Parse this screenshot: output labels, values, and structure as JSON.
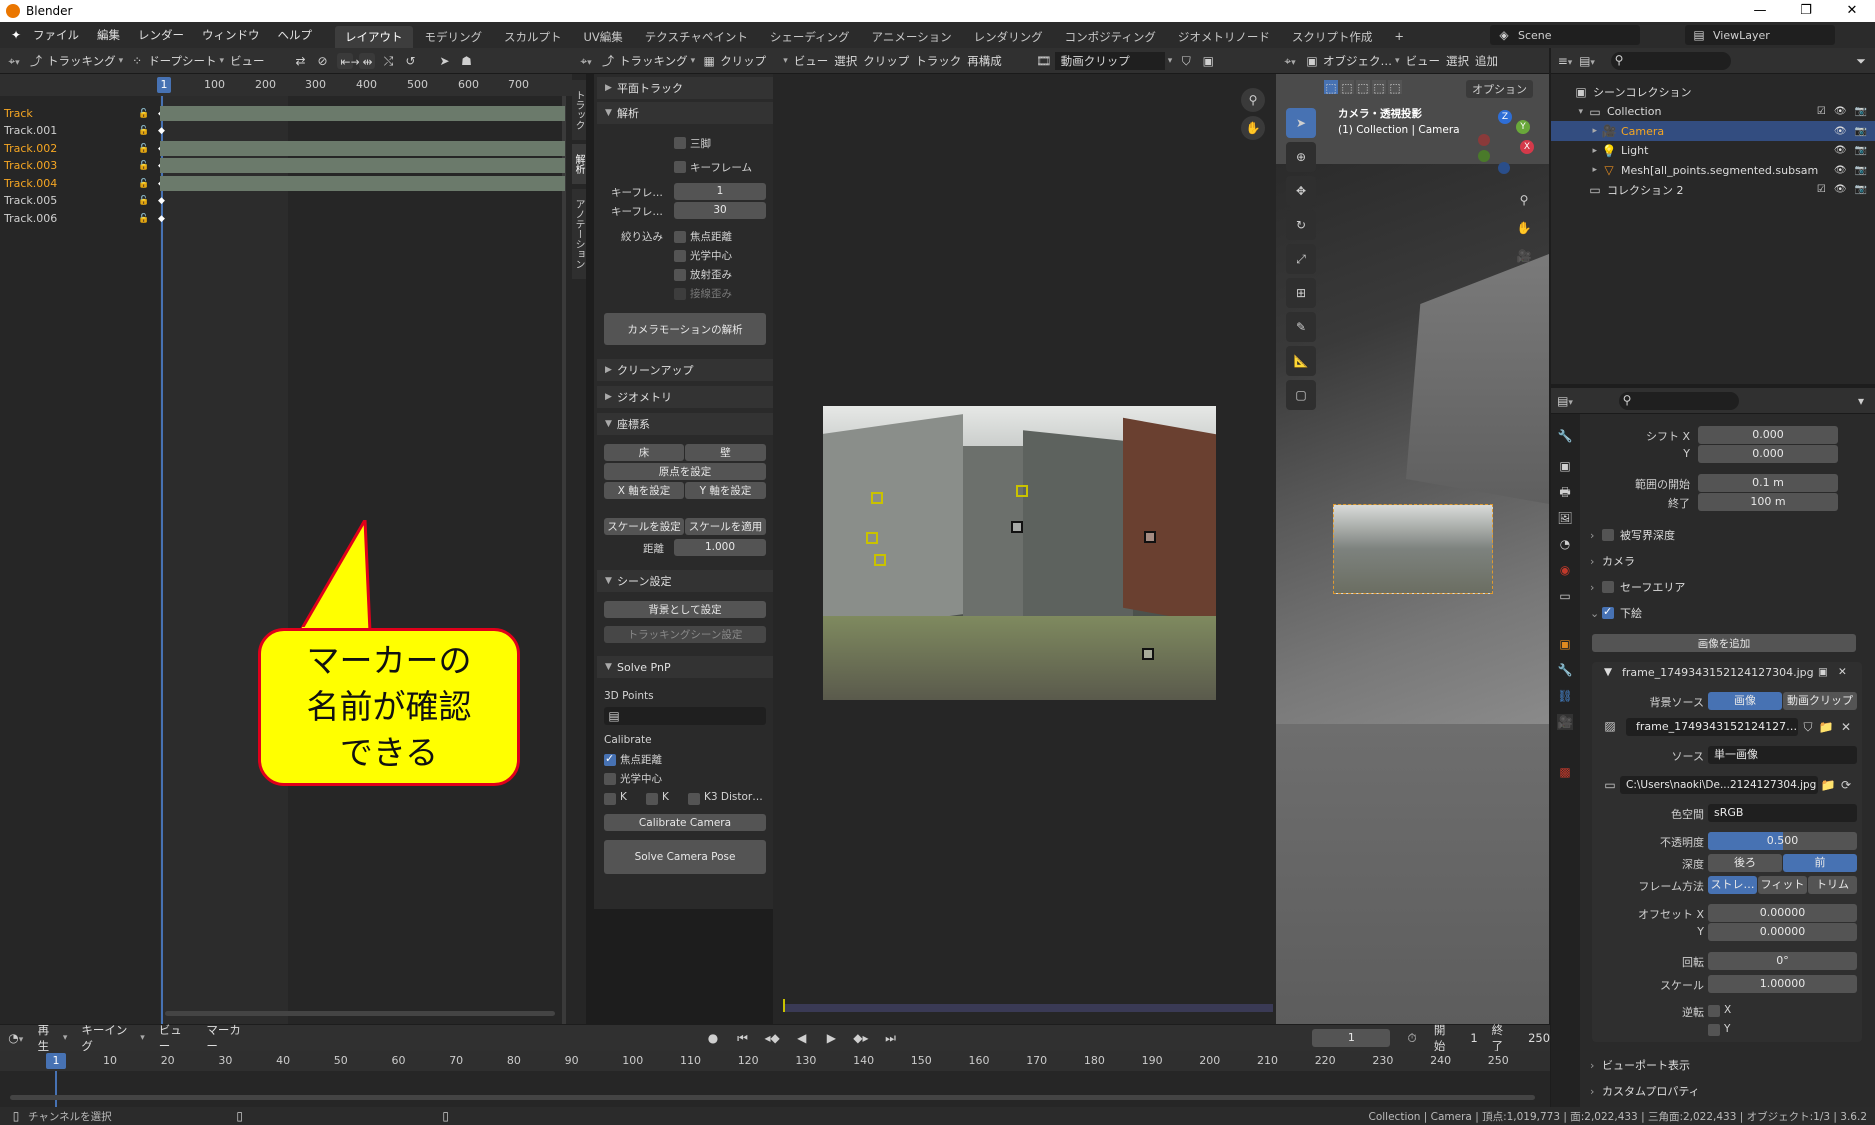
{
  "window": {
    "title": "Blender",
    "min": "—",
    "max": "❐",
    "close": "✕"
  },
  "menu": [
    "ファイル",
    "編集",
    "レンダー",
    "ウィンドウ",
    "ヘルプ"
  ],
  "workspaces": [
    "レイアウト",
    "モデリング",
    "スカルプト",
    "UV編集",
    "テクスチャペイント",
    "シェーディング",
    "アニメーション",
    "レンダリング",
    "コンポジティング",
    "ジオメトリノード",
    "スクリプト作成"
  ],
  "active_workspace": "レイアウト",
  "scene": {
    "scene_name": "Scene",
    "view_layer": "ViewLayer"
  },
  "dopesheet": {
    "mode": "トラッキング",
    "editor": "ドープシート",
    "view": "ビュー",
    "current_frame": "1",
    "ruler": [
      "100",
      "200",
      "300",
      "400",
      "500",
      "600",
      "700"
    ],
    "tracks": [
      {
        "name": "Track",
        "selected": true,
        "bar": true
      },
      {
        "name": "Track.001",
        "selected": false,
        "bar": false
      },
      {
        "name": "Track.002",
        "selected": true,
        "bar": true
      },
      {
        "name": "Track.003",
        "selected": true,
        "bar": true
      },
      {
        "name": "Track.004",
        "selected": true,
        "bar": true
      },
      {
        "name": "Track.005",
        "selected": false,
        "bar": false
      },
      {
        "name": "Track.006",
        "selected": false,
        "bar": false
      }
    ]
  },
  "clip_header": {
    "mode": "トラッキング",
    "clip": "クリップ",
    "menus": [
      "ビュー",
      "選択",
      "クリップ",
      "トラック",
      "再構成"
    ],
    "clip_type": "動画クリップ"
  },
  "side_tabs": [
    "トラック",
    "解析",
    "アノテーション"
  ],
  "solve_panel": {
    "plane_track": "平面トラック",
    "solve": "解析",
    "tripod": "三脚",
    "keyframe": "キーフレーム",
    "keyframe_a_label": "キーフレ…",
    "keyframe_a": "1",
    "keyframe_b_label": "キーフレ…",
    "keyframe_b": "30",
    "refine_label": "絞り込み",
    "focal": "焦点距離",
    "optical_center": "光学中心",
    "radial": "放射歪み",
    "tangential": "接線歪み",
    "solve_btn": "カメラモーションの解析",
    "cleanup": "クリーンアップ",
    "geometry": "ジオメトリ",
    "orientation": "座標系",
    "floor": "床",
    "wall": "壁",
    "set_origin": "原点を設定",
    "set_x": "X 軸を設定",
    "set_y": "Y 軸を設定",
    "set_scale": "スケールを設定",
    "apply_scale": "スケールを適用",
    "distance_label": "距離",
    "distance": "1.000",
    "scene_setup": "シーン設定",
    "set_bg": "背景として設定",
    "tracking_scene": "トラッキングシーン設定",
    "solve_pnp": "Solve PnP",
    "points_3d": "3D Points",
    "calibrate": "Calibrate",
    "cal_focal": "焦点距離",
    "cal_optical": "光学中心",
    "k1": "K",
    "k2": "K",
    "k3": "K3 Distor…",
    "calibrate_btn": "Calibrate Camera",
    "solve_pose_btn": "Solve Camera Pose"
  },
  "viewport": {
    "mode": "オブジェク…",
    "menus": [
      "ビュー",
      "選択",
      "追加"
    ],
    "options": "オプション",
    "camera_text": "カメラ・透視投影",
    "collection_text": "(1) Collection | Camera"
  },
  "outliner": {
    "rows": [
      {
        "label": "シーンコレクション",
        "depth": 0
      },
      {
        "label": "Collection",
        "depth": 1
      },
      {
        "label": "Camera",
        "depth": 2,
        "selected": true
      },
      {
        "label": "Light",
        "depth": 2
      },
      {
        "label": "Mesh[all_points.segmented.subsam",
        "depth": 2
      },
      {
        "label": "コレクション 2",
        "depth": 1
      }
    ]
  },
  "properties": {
    "shift_x_label": "シフト X",
    "shift_x": "0.000",
    "shift_y_label": "Y",
    "shift_y": "0.000",
    "clip_start_label": "範囲の開始",
    "clip_start": "0.1 m",
    "clip_end_label": "終了",
    "clip_end": "100 m",
    "dof": "被写界深度",
    "camera": "カメラ",
    "safe_area": "セーフエリア",
    "bg_images": "下絵",
    "add_image": "画像を追加",
    "image_name": "frame_1749343152124127304.jpg",
    "bg_source_label": "背景ソース",
    "bg_source_image": "画像",
    "bg_source_clip": "動画クリップ",
    "image_field": "frame_1749343152124127…",
    "source_label": "ソース",
    "source": "単一画像",
    "filepath": "C:\\Users\\naoki\\De...2124127304.jpg",
    "colorspace_label": "色空間",
    "colorspace": "sRGB",
    "opacity_label": "不透明度",
    "opacity": "0.500",
    "opacity_fraction": 0.5,
    "depth_label": "深度",
    "depth_back": "後ろ",
    "depth_front": "前",
    "frame_method_label": "フレーム方法",
    "frame_stretch": "ストレ…",
    "frame_fit": "フィット",
    "frame_crop": "トリム",
    "offset_x_label": "オフセット X",
    "offset_x": "0.00000",
    "offset_y_label": "Y",
    "offset_y": "0.00000",
    "rotation_label": "回転",
    "rotation": "0°",
    "scale_label": "スケール",
    "scale": "1.00000",
    "flip_label": "逆転",
    "flip_x": "X",
    "flip_y": "Y",
    "viewport_display": "ビューポート表示",
    "custom_props": "カスタムプロパティ"
  },
  "timeline": {
    "playback": "再生",
    "keying": "キーイング",
    "view": "ビュー",
    "marker": "マーカー",
    "frame": "1",
    "start_label": "開始",
    "start": "1",
    "end_label": "終了",
    "end": "250",
    "current": "1",
    "ticks": [
      "10",
      "20",
      "30",
      "40",
      "50",
      "60",
      "70",
      "80",
      "90",
      "100",
      "110",
      "120",
      "130",
      "140",
      "150",
      "160",
      "170",
      "180",
      "190",
      "200",
      "210",
      "220",
      "230",
      "240",
      "250"
    ]
  },
  "status": {
    "left": "チャンネルを選択",
    "right": "Collection | Camera | 頂点:1,019,773 | 面:2,022,433 | 三角面:2,022,433 | オブジェクト:1/3 | 3.6.2"
  },
  "callout": {
    "line1": "マーカーの",
    "line2": "名前が確認",
    "line3": "できる"
  }
}
